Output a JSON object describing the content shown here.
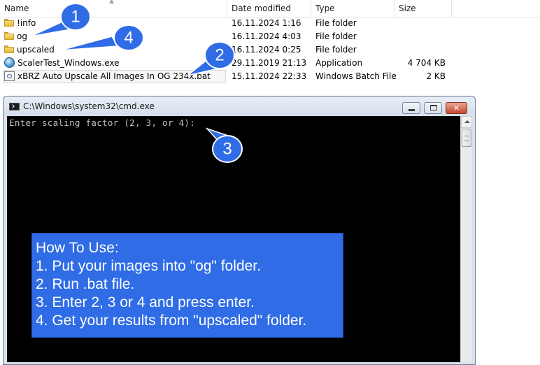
{
  "explorer": {
    "columns": {
      "name": "Name",
      "date": "Date modified",
      "type": "Type",
      "size": "Size"
    },
    "files": [
      {
        "name": "!info",
        "date": "16.11.2024 1:16",
        "type": "File folder",
        "size": "",
        "icon": "folder-icon"
      },
      {
        "name": "og",
        "date": "16.11.2024 4:03",
        "type": "File folder",
        "size": "",
        "icon": "folder-icon"
      },
      {
        "name": "upscaled",
        "date": "16.11.2024 0:25",
        "type": "File folder",
        "size": "",
        "icon": "folder-icon"
      },
      {
        "name": "ScalerTest_Windows.exe",
        "date": "29.11.2019 21:13",
        "type": "Application",
        "size": "4 704 KB",
        "icon": "application-icon"
      },
      {
        "name": "xBRZ Auto Upscale All Images In OG 234x.bat",
        "date": "15.11.2024 22:33",
        "type": "Windows Batch File",
        "size": "2 KB",
        "icon": "batch-file-icon"
      }
    ]
  },
  "console": {
    "title": "C:\\Windows\\system32\\cmd.exe",
    "prompt": "Enter scaling factor (2, 3, or 4):"
  },
  "howto": {
    "heading": "How To Use:",
    "steps": [
      "1. Put your images into \"og\" folder.",
      "2. Run .bat file.",
      "3. Enter 2, 3 or 4 and press enter.",
      "4. Get your results from \"upscaled\" folder."
    ]
  },
  "callouts": [
    "1",
    "2",
    "3",
    "4"
  ],
  "colors": {
    "callout_blue": "#2f6ce6",
    "console_bg": "#000000",
    "console_text": "#c0c0c0"
  }
}
